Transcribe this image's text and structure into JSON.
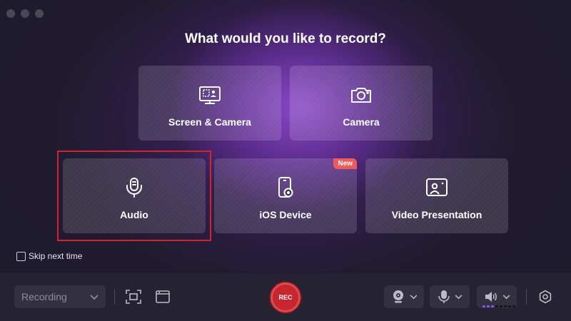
{
  "window": {
    "traffic_lights": [
      "close",
      "minimize",
      "zoom"
    ]
  },
  "title": "What would you like to record?",
  "options": {
    "screen_camera": {
      "label": "Screen & Camera",
      "icon": "screen-camera-icon"
    },
    "camera": {
      "label": "Camera",
      "icon": "camera-icon"
    },
    "audio": {
      "label": "Audio",
      "icon": "microphone-icon",
      "highlighted": true
    },
    "ios_device": {
      "label": "iOS Device",
      "icon": "ios-device-icon",
      "badge": "New"
    },
    "video_presentation": {
      "label": "Video Presentation",
      "icon": "presentation-icon"
    }
  },
  "skip": {
    "label": "Skip next time",
    "checked": false
  },
  "toolbar": {
    "mode_select": {
      "value": "Recording"
    },
    "rec_label": "REC",
    "mic_level": {
      "active_bars": 3,
      "total_bars": 8
    }
  },
  "colors": {
    "accent_purple": "#8a56e6",
    "rec_red": "#c6262d",
    "new_badge": "#f05a5a",
    "highlight_border": "#d3232c",
    "background": "#1e1b2c"
  }
}
